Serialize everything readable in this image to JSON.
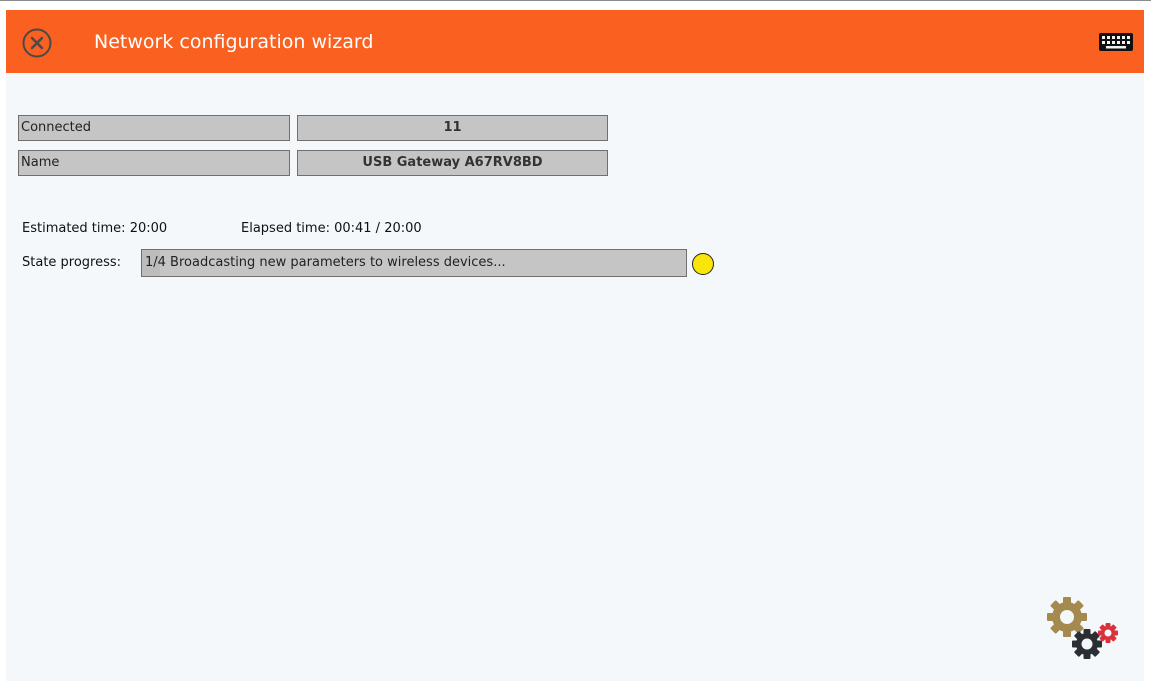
{
  "window": {
    "title": "Network configuration wizard",
    "accent_color": "#fa6120",
    "close_icon": "close-circle-icon",
    "keyboard_icon": "keyboard-icon"
  },
  "info": {
    "rows": [
      {
        "label": "Connected",
        "value": "11"
      },
      {
        "label": "Name",
        "value": "USB Gateway A67RV8BD"
      }
    ]
  },
  "timing": {
    "estimated": "Estimated time: 20:00",
    "elapsed": "Elapsed time: 00:41 / 20:00"
  },
  "state": {
    "label": "State progress:",
    "text": "1/4 Broadcasting new parameters to wireless devices...",
    "progress_fraction": 0.034,
    "status_color": "#f9e50a"
  },
  "decor": {
    "logo_icon": "gears-icon"
  }
}
